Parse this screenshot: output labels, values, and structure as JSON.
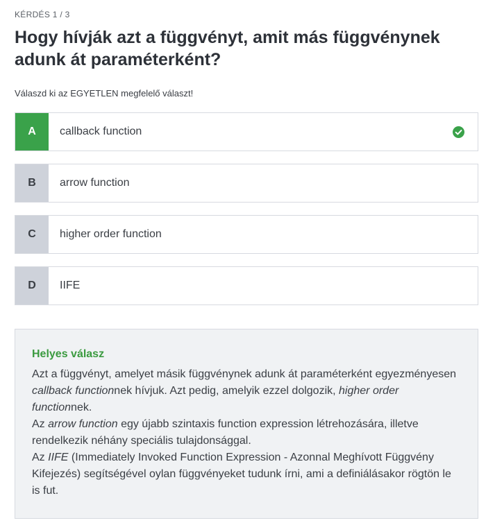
{
  "header": {
    "counter": "KÉRDÉS 1 / 3",
    "question": "Hogy hívják azt a függvényt, amit más függvénynek adunk át paraméterként?",
    "instruction": "Válaszd ki az EGYETLEN megfelelő választ!"
  },
  "options": [
    {
      "letter": "A",
      "text": "callback function",
      "correct": true
    },
    {
      "letter": "B",
      "text": "arrow function",
      "correct": false
    },
    {
      "letter": "C",
      "text": "higher order function",
      "correct": false
    },
    {
      "letter": "D",
      "text": "IIFE",
      "correct": false
    }
  ],
  "explanation": {
    "title": "Helyes válasz",
    "p1_a": "Azt a függvényt, amelyet másik függvénynek adunk át paraméterként egyezményesen ",
    "p1_em1": "callback function",
    "p1_b": "nek hívjuk.  Azt pedig, amelyik ezzel dolgozik, ",
    "p1_em2": "higher order function",
    "p1_c": "nek.",
    "p2_a": "Az ",
    "p2_em": "arrow function ",
    "p2_b": " egy újabb szintaxis function expression létrehozására, illetve rendelkezik néhány speciális tulajdonsággal.",
    "p3_a": "Az ",
    "p3_em": "IIFE",
    "p3_b": " (Immediately Invoked Function Expression - Azonnal Meghívott Függvény Kifejezés) segítségével oylan függvényeket tudunk írni, ami a definiálásakor rögtön le is fut."
  },
  "colors": {
    "correct_green": "#3aa24a",
    "title_green": "#3a9a3f",
    "letter_grey": "#ced2da",
    "panel_bg": "#f0f2f4"
  },
  "icons": {
    "correct": "check-circle-icon"
  }
}
